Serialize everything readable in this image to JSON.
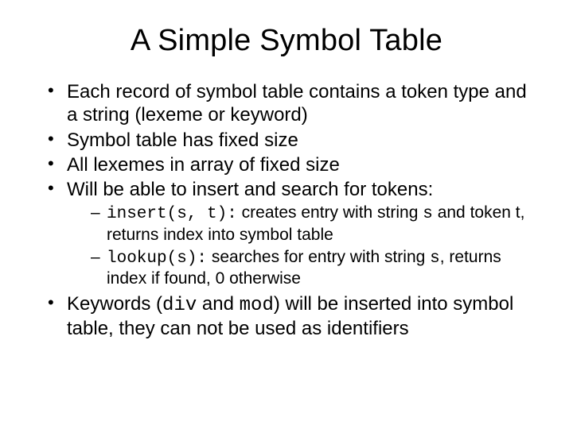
{
  "title": "A Simple Symbol Table",
  "b1": "Each record of symbol table contains a token type and a string (lexeme or keyword)",
  "b2": "Symbol table has fixed size",
  "b3": "All lexemes in array of fixed size",
  "b4": "Will be able to insert and search for tokens:",
  "s1_code": "insert(s, t):",
  "s1_a": " creates entry with string ",
  "s1_code2": "s",
  "s1_b": " and token t, returns index into symbol table",
  "s2_code": "lookup(s):",
  "s2_a": " searches for entry with string ",
  "s2_code2": "s",
  "s2_b": ", returns index if found, 0 otherwise",
  "b5_a": "Keywords (",
  "b5_code1": "div",
  "b5_b": " and ",
  "b5_code2": "mod",
  "b5_c": ") will be inserted into symbol table, they can not be used as identifiers"
}
